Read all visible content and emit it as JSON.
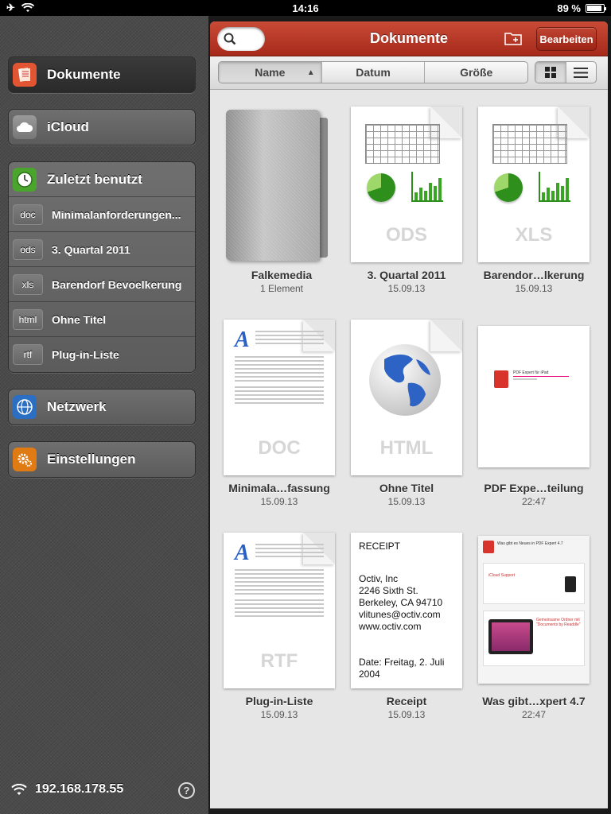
{
  "status": {
    "time": "14:16",
    "battery": "89 %",
    "battery_level": 0.89
  },
  "sidebar": {
    "main_items": [
      {
        "label": "Dokumente",
        "icon": "documents-icon",
        "color": "#e25532"
      },
      {
        "label": "iCloud",
        "icon": "cloud-icon",
        "color": "#8a8a8a"
      }
    ],
    "recent": {
      "label": "Zuletzt benutzt",
      "icon": "clock-icon",
      "color": "#4aa52c"
    },
    "recent_items": [
      {
        "tag": "doc",
        "label": "Minimalanforderungen..."
      },
      {
        "tag": "ods",
        "label": "3. Quartal 2011"
      },
      {
        "tag": "xls",
        "label": "Barendorf Bevoelkerung"
      },
      {
        "tag": "html",
        "label": "Ohne Titel"
      },
      {
        "tag": "rtf",
        "label": "Plug-in-Liste"
      }
    ],
    "network": {
      "label": "Netzwerk",
      "icon": "globe-icon",
      "color": "#2a6fc4"
    },
    "settings": {
      "label": "Einstellungen",
      "icon": "gears-icon",
      "color": "#e07a12"
    },
    "ip": "192.168.178.55",
    "help": "?"
  },
  "header": {
    "title": "Dokumente",
    "edit_label": "Bearbeiten"
  },
  "sort": {
    "tabs": [
      "Name",
      "Datum",
      "Größe"
    ],
    "selected": "Name",
    "arrow": "▲"
  },
  "files": [
    {
      "name": "Falkemedia",
      "meta": "1 Element",
      "kind": "folder"
    },
    {
      "name": "3. Quartal 2011",
      "meta": "15.09.13",
      "kind": "ODS"
    },
    {
      "name": "Barendor…lkerung",
      "meta": "15.09.13",
      "kind": "XLS"
    },
    {
      "name": "Minimala…fassung",
      "meta": "15.09.13",
      "kind": "DOC"
    },
    {
      "name": "Ohne Titel",
      "meta": "15.09.13",
      "kind": "HTML"
    },
    {
      "name": "PDF Expe…teilung",
      "meta": "22:47",
      "kind": "pdf"
    },
    {
      "name": "Plug-in-Liste",
      "meta": "15.09.13",
      "kind": "RTF"
    },
    {
      "name": "Receipt",
      "meta": "15.09.13",
      "kind": "receipt"
    },
    {
      "name": "Was gibt…xpert 4.7",
      "meta": "22:47",
      "kind": "pdf2"
    }
  ],
  "receipt_text": {
    "heading": "RECEIPT",
    "lines": [
      "Octiv, Inc",
      "2246 Sixth St.",
      "Berkeley, CA  94710",
      "vlitunes@octiv.com",
      "www.octiv.com"
    ],
    "date": "Date:  Freitag, 2. Juli 2004"
  },
  "pdf_thumb": {
    "title": "PDF Expert für iPad"
  },
  "pdf2_thumb": {
    "title": "Was gibt es Neues in PDF Expert 4.7",
    "box1": "iCloud Support",
    "box2": "Gemeinsame Ordner mit \"Documents by Readdle\""
  }
}
